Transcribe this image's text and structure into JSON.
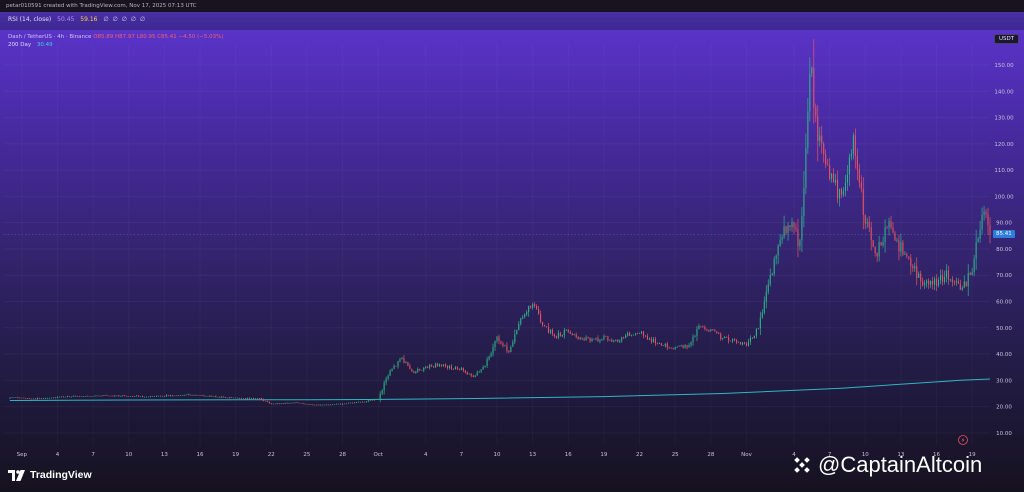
{
  "header": {
    "credit": "petar010591 created with TradingView.com, Nov 17, 2025 07:13 UTC"
  },
  "rsi_pane": {
    "label": "RSI (14, close)",
    "value1": "50.45",
    "value2": "59.16",
    "icons": "∅ ∅ ∅ ∅ ∅"
  },
  "legend": {
    "symbol": "Dash / TetherUS · 4h · Binance",
    "ohlc": "O85.89 H87.97 L80.95 C85.41 −4.50 (−5.03%)",
    "ma_label": "200 Day",
    "ma_value": "30.49"
  },
  "currency_label": "USDT",
  "last_price_label": "85.41",
  "brand": {
    "name": "TradingView"
  },
  "watermark": {
    "text": "@CaptainAltcoin"
  },
  "colors": {
    "up": "#2bb48a",
    "down": "#e8525e",
    "ma": "#2fb6c3",
    "accent": "#2f7bdc"
  },
  "chart_data": {
    "type": "candlestick",
    "title": "",
    "xlabel": "",
    "ylabel": "",
    "ylim": [
      5,
      158
    ],
    "y_ticks": [
      "150.00",
      "140.00",
      "130.00",
      "120.00",
      "110.00",
      "100.00",
      "90.00",
      "80.00",
      "70.00",
      "60.00",
      "50.00",
      "40.00",
      "30.00",
      "20.00",
      "10.00"
    ],
    "y_tick_values": [
      150,
      140,
      130,
      120,
      110,
      100,
      90,
      80,
      70,
      60,
      50,
      40,
      30,
      20,
      10
    ],
    "x_tick_labels": [
      "Sep",
      "4",
      "7",
      "10",
      "13",
      "16",
      "19",
      "22",
      "25",
      "28",
      "Oct",
      "4",
      "7",
      "10",
      "13",
      "16",
      "19",
      "22",
      "25",
      "28",
      "Nov",
      "4",
      "7",
      "10",
      "13",
      "16",
      "19"
    ],
    "x_tick_days": [
      1,
      4,
      7,
      10,
      13,
      16,
      19,
      22,
      25,
      28,
      31,
      35,
      38,
      41,
      44,
      47,
      50,
      53,
      56,
      59,
      62,
      66,
      69,
      72,
      75,
      78,
      81
    ],
    "x_range_days": [
      -0.5,
      82.5
    ],
    "x_axis_note": "days counted from Sep 1, 2025",
    "candles_per_day": 6,
    "last_price": 85.41,
    "close_waypoints": [
      [
        0,
        23.5
      ],
      [
        2,
        23
      ],
      [
        5,
        23.8
      ],
      [
        8,
        24.2
      ],
      [
        12,
        23.8
      ],
      [
        15,
        24.5
      ],
      [
        18,
        23.5
      ],
      [
        21,
        23
      ],
      [
        22,
        21
      ],
      [
        24,
        21.5
      ],
      [
        26,
        20.5
      ],
      [
        28,
        21
      ],
      [
        30,
        22
      ],
      [
        31,
        23
      ],
      [
        32,
        34
      ],
      [
        33,
        38
      ],
      [
        34,
        33
      ],
      [
        35,
        35
      ],
      [
        36,
        36
      ],
      [
        37,
        35
      ],
      [
        38,
        34
      ],
      [
        39,
        31
      ],
      [
        40,
        36
      ],
      [
        41,
        46
      ],
      [
        42,
        41
      ],
      [
        43,
        54
      ],
      [
        44,
        59
      ],
      [
        45,
        50
      ],
      [
        46,
        47
      ],
      [
        47,
        49
      ],
      [
        48,
        46
      ],
      [
        49,
        45
      ],
      [
        50,
        46
      ],
      [
        51,
        45
      ],
      [
        52,
        47
      ],
      [
        53,
        48
      ],
      [
        54,
        45
      ],
      [
        55,
        44
      ],
      [
        56,
        42
      ],
      [
        57,
        43
      ],
      [
        58,
        50
      ],
      [
        59,
        49
      ],
      [
        60,
        46
      ],
      [
        61,
        45
      ],
      [
        62,
        43
      ],
      [
        63,
        50
      ],
      [
        64,
        70
      ],
      [
        65,
        86
      ],
      [
        66,
        88
      ],
      [
        66.5,
        82
      ],
      [
        67,
        118
      ],
      [
        67.4,
        148
      ],
      [
        68,
        125
      ],
      [
        69,
        108
      ],
      [
        70,
        100
      ],
      [
        70.5,
        112
      ],
      [
        71,
        122
      ],
      [
        71.5,
        104
      ],
      [
        72,
        92
      ],
      [
        73,
        78
      ],
      [
        74,
        90
      ],
      [
        75,
        80
      ],
      [
        76,
        72
      ],
      [
        77,
        67
      ],
      [
        78,
        67
      ],
      [
        79,
        70
      ],
      [
        80,
        64
      ],
      [
        81,
        72
      ],
      [
        81.8,
        92
      ],
      [
        82,
        97
      ],
      [
        82.5,
        85.41
      ]
    ],
    "series": [
      {
        "name": "200 Day",
        "x": [
          0,
          10,
          20,
          25,
          30,
          35,
          40,
          50,
          60,
          70,
          80,
          82.5
        ],
        "values": [
          22.3,
          22.5,
          22.6,
          22.6,
          22.7,
          22.9,
          23.1,
          23.8,
          25.0,
          27.0,
          30.0,
          30.5
        ]
      }
    ]
  }
}
